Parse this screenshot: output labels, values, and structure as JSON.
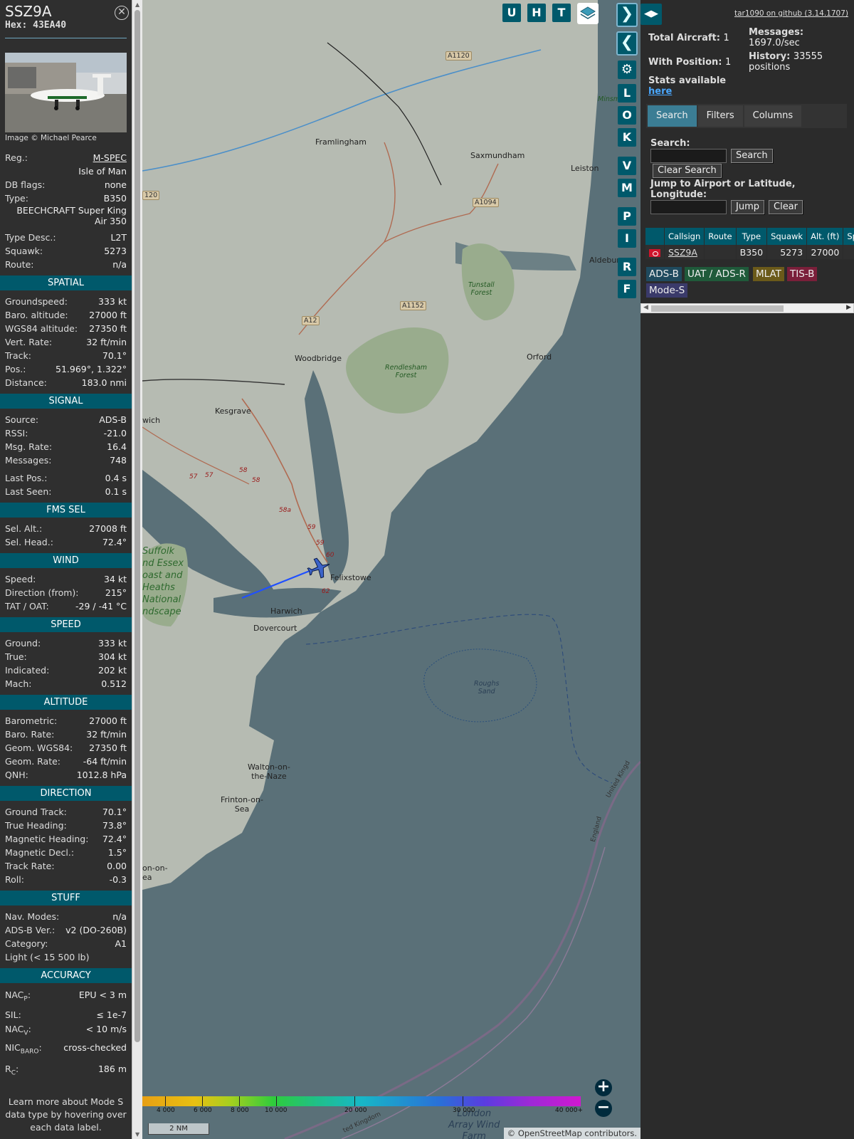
{
  "sidebar": {
    "callsign": "SSZ9A",
    "hex_label": "Hex:",
    "hex": "43EA40",
    "photo_credit": "Image © Michael Pearce",
    "reg_label": "Reg.:",
    "reg": "M-SPEC",
    "country": "Isle of Man",
    "dbflags_label": "DB flags:",
    "dbflags": "none",
    "type_label": "Type:",
    "type": "B350",
    "type_full": [
      "BEECHCRAFT Super King",
      "Air 350"
    ],
    "typedesc_label": "Type Desc.:",
    "typedesc": "L2T",
    "squawk_label": "Squawk:",
    "squawk": "5273",
    "route_label": "Route:",
    "route": "n/a",
    "sections": {
      "spatial": "SPATIAL",
      "signal": "SIGNAL",
      "fms": "FMS SEL",
      "wind": "WIND",
      "speed": "SPEED",
      "altitude": "ALTITUDE",
      "direction": "DIRECTION",
      "stuff": "STUFF",
      "accuracy": "ACCURACY"
    },
    "spatial": [
      {
        "l": "Groundspeed:",
        "v": "333 kt"
      },
      {
        "l": "Baro. altitude:",
        "v": "27000 ft"
      },
      {
        "l": "WGS84 altitude:",
        "v": "27350 ft"
      },
      {
        "l": "Vert. Rate:",
        "v": "32 ft/min"
      },
      {
        "l": "Track:",
        "v": "70.1°"
      },
      {
        "l": "Pos.:",
        "v": "51.969°, 1.322°"
      },
      {
        "l": "Distance:",
        "v": "183.0 nmi"
      }
    ],
    "signal": [
      {
        "l": "Source:",
        "v": "ADS-B"
      },
      {
        "l": "RSSI:",
        "v": "-21.0"
      },
      {
        "l": "Msg. Rate:",
        "v": "16.4"
      },
      {
        "l": "Messages:",
        "v": "748"
      }
    ],
    "signal2": [
      {
        "l": "Last Pos.:",
        "v": "0.4 s"
      },
      {
        "l": "Last Seen:",
        "v": "0.1 s"
      }
    ],
    "fms": [
      {
        "l": "Sel. Alt.:",
        "v": "27008 ft"
      },
      {
        "l": "Sel. Head.:",
        "v": "72.4°"
      }
    ],
    "wind": [
      {
        "l": "Speed:",
        "v": "34 kt"
      },
      {
        "l": "Direction (from):",
        "v": "215°"
      },
      {
        "l": "TAT / OAT:",
        "v": "-29 / -41 °C"
      }
    ],
    "speed": [
      {
        "l": "Ground:",
        "v": "333 kt"
      },
      {
        "l": "True:",
        "v": "304 kt"
      },
      {
        "l": "Indicated:",
        "v": "202 kt"
      },
      {
        "l": "Mach:",
        "v": "0.512"
      }
    ],
    "altitude": [
      {
        "l": "Barometric:",
        "v": "27000 ft"
      },
      {
        "l": "Baro. Rate:",
        "v": "32 ft/min"
      },
      {
        "l": "Geom. WGS84:",
        "v": "27350 ft"
      },
      {
        "l": "Geom. Rate:",
        "v": "-64 ft/min"
      },
      {
        "l": "QNH:",
        "v": "1012.8 hPa"
      }
    ],
    "direction": [
      {
        "l": "Ground Track:",
        "v": "70.1°"
      },
      {
        "l": "True Heading:",
        "v": "73.8°"
      },
      {
        "l": "Magnetic Heading:",
        "v": "72.4°"
      },
      {
        "l": "Magnetic Decl.:",
        "v": "1.5°"
      },
      {
        "l": "Track Rate:",
        "v": "0.00"
      },
      {
        "l": "Roll:",
        "v": "-0.3"
      }
    ],
    "stuff": [
      {
        "l": "Nav. Modes:",
        "v": "n/a"
      },
      {
        "l": "ADS-B Ver.:",
        "v": "v2 (DO-260B)"
      },
      {
        "l": "Category:",
        "v": "A1"
      }
    ],
    "category_desc": "Light (< 15 500 lb)",
    "accuracy": {
      "nacp_label": "NAC",
      "nacp_sub": "P",
      "nacp": "EPU < 3 m",
      "sil_label": "SIL:",
      "sil": "≤ 1e-7",
      "nacv_label": "NAC",
      "nacv_sub": "V",
      "nacv": "< 10 m/s",
      "nicbaro_label": "NIC",
      "nicbaro_sub": "BARO",
      "nicbaro": "cross-checked",
      "rc_label": "R",
      "rc_sub": "C",
      "rc": "186 m"
    },
    "footer": "Learn more about Mode S data type by hovering over each data label."
  },
  "map": {
    "places": {
      "framlingham": "Framlingham",
      "saxmundham": "Saxmundham",
      "leiston": "Leiston",
      "aldeburgh": "Aldebur",
      "minsm": "Minsm",
      "woodbridge": "Woodbridge",
      "orford": "Orford",
      "kesgrave": "Kesgrave",
      "wich": "wich",
      "felixstowe": "Felixstowe",
      "harwich": "Harwich",
      "dovercourt": "Dovercourt",
      "walton": "Walton-on-\nthe-Naze",
      "frinton": "Frinton-on-\nSea",
      "onon": "on-on-\nea",
      "tunstall": "Tunstall\nForest",
      "rendlesham": "Rendlesham\nForest",
      "roughs": "Roughs\nSand",
      "aonb": "Suffolk\nnd Essex\noast and\nHeaths\nNational\nndscape",
      "london_array": "London\nArray Wind\nFarm",
      "england": "England",
      "uk1": "United Kingd",
      "uk2": "ted Kingdom"
    },
    "roads": {
      "a1120": "A1120",
      "a120": "120",
      "a1094": "A1094",
      "a1152": "A1152",
      "a12": "A12"
    },
    "junctions": [
      "57",
      "57",
      "58",
      "58",
      "58a",
      "59",
      "59",
      "60",
      "62"
    ],
    "buttons": {
      "u": "U",
      "h": "H",
      "t": "T",
      "l": "L",
      "o": "O",
      "k": "K",
      "v": "V",
      "m": "M",
      "p": "P",
      "i": "I",
      "r": "R",
      "f": "F"
    },
    "legend_labels": [
      "4 000",
      "6 000",
      "8 000",
      "10 000",
      "20 000",
      "30 000",
      "40 000+"
    ],
    "scale": "2 NM",
    "attribution_prefix": "© ",
    "attribution_link": "OpenStreetMap",
    "attribution_suffix": " contributors.",
    "zoom_in": "+",
    "zoom_out": "−"
  },
  "panel": {
    "github": "tar1090 on github (3.14.1707)",
    "total_label": "Total Aircraft:",
    "total": "1",
    "withpos_label": "With Position:",
    "withpos": "1",
    "stats_label": "Stats available",
    "stats_link": "here",
    "messages_label": "Messages:",
    "messages": "1697.0/sec",
    "history_label": "History:",
    "history": "33555",
    "history_unit": "positions",
    "tabs": [
      "Search",
      "Filters",
      "Columns"
    ],
    "search_label": "Search:",
    "search_btn": "Search",
    "clear_search_btn": "Clear Search",
    "jump_label": "Jump to Airport or Latitude, Longitude:",
    "jump_btn": "Jump",
    "clear_btn": "Clear",
    "table": {
      "headers": [
        "",
        "Callsign",
        "Route",
        "Type",
        "Squawk",
        "Alt. (ft)",
        "Spd."
      ],
      "rows": [
        {
          "callsign": "SSZ9A",
          "route": "",
          "type": "B350",
          "squawk": "5273",
          "alt": "27000",
          "spd": ""
        }
      ]
    },
    "sources": [
      "ADS-B",
      "UAT / ADS-R",
      "MLAT",
      "TIS-B",
      "Mode-S"
    ]
  },
  "colors": {
    "accent": "#00596b",
    "ads_b": "#1f4a5e",
    "uat": "#1f5a3a",
    "mlat": "#6b5a1a",
    "tisb": "#7a1f3a",
    "modes": "#3a3a6a"
  }
}
